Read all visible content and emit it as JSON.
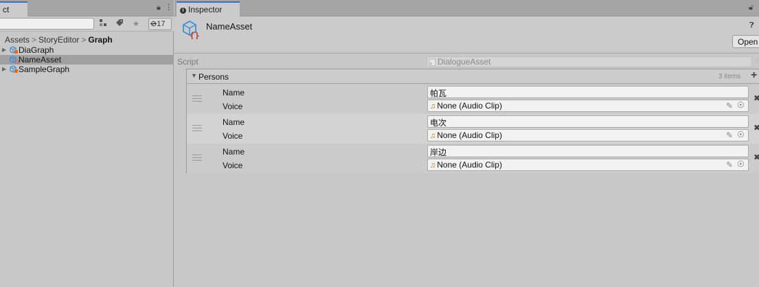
{
  "project": {
    "tab_label": "ct",
    "hidden_count": "17",
    "breadcrumb": [
      "Assets",
      "StoryEditor",
      "Graph"
    ],
    "items": [
      {
        "label": "DiaGraph",
        "foldable": true,
        "selected": false
      },
      {
        "label": "NameAsset",
        "foldable": false,
        "selected": true
      },
      {
        "label": "SampleGraph",
        "foldable": true,
        "selected": false
      }
    ]
  },
  "inspector": {
    "tab_label": "Inspector",
    "asset_title": "NameAsset",
    "open_label": "Open",
    "script_label": "Script",
    "script_value": "DialogueAsset",
    "list": {
      "title": "Persons",
      "count": "3 items",
      "name_label": "Name",
      "voice_label": "Voice",
      "elements": [
        {
          "name": "帕瓦",
          "voice": "None (Audio Clip)"
        },
        {
          "name": "电次",
          "voice": "None (Audio Clip)"
        },
        {
          "name": "岸边",
          "voice": "None (Audio Clip)"
        }
      ]
    }
  },
  "colors": {
    "tab_accent": "#3a72b0",
    "selection": "#a0a0a0",
    "prefab_icon": "#3a8fd6",
    "asset_icon_brace": "#c0392b"
  }
}
